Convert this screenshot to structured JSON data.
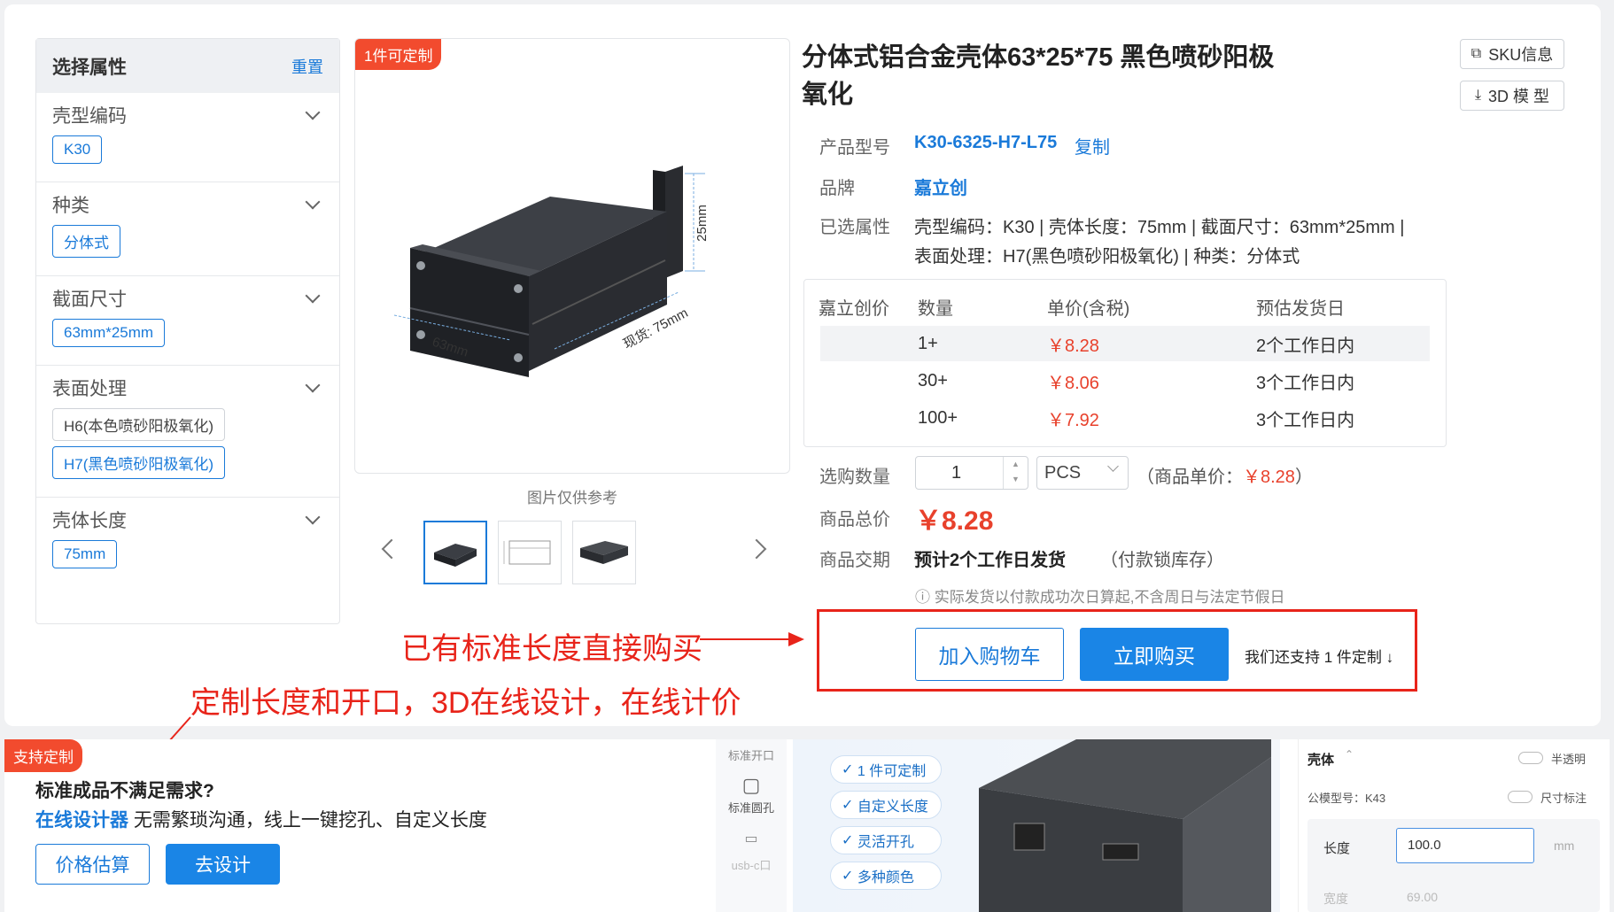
{
  "filter": {
    "title": "选择属性",
    "reset": "重置",
    "sections": [
      {
        "label": "壳型编码",
        "options": [
          "K30"
        ]
      },
      {
        "label": "种类",
        "options": [
          "分体式"
        ]
      },
      {
        "label": "截面尺寸",
        "options": [
          "63mm*25mm"
        ]
      },
      {
        "label": "表面处理",
        "options": [
          "H6(本色喷砂阳极氧化)",
          "H7(黑色喷砂阳极氧化)"
        ]
      },
      {
        "label": "壳体长度",
        "options": [
          "75mm"
        ]
      }
    ]
  },
  "gallery": {
    "badge": "1件可定制",
    "dim_height": "25mm",
    "dim_width": "63mm",
    "dim_length": "现货: 75mm",
    "note": "图片仅供参考"
  },
  "product": {
    "title_line1": "分体式铝合金壳体63*25*75 黑色喷砂阳极",
    "title_line2": "氧化",
    "sku_button": "SKU信息",
    "model3d_button": "3D 模 型",
    "model_label": "产品型号",
    "model_value": "K30-6325-H7-L75",
    "copy": "复制",
    "brand_label": "品牌",
    "brand_value": "嘉立创",
    "attr_label": "已选属性",
    "attr_line1": "壳型编码：K30 | 壳体长度：75mm | 截面尺寸：63mm*25mm |",
    "attr_line2": "表面处理：H7(黑色喷砂阳极氧化) | 种类：分体式"
  },
  "price_table": {
    "headers": [
      "嘉立创价",
      "数量",
      "单价(含税)",
      "预估发货日"
    ],
    "rows": [
      {
        "qty": "1+",
        "price": "￥8.28",
        "ship": "2个工作日内"
      },
      {
        "qty": "30+",
        "price": "￥8.06",
        "ship": "3个工作日内"
      },
      {
        "qty": "100+",
        "price": "￥7.92",
        "ship": "3个工作日内"
      }
    ]
  },
  "order": {
    "qty_label": "选购数量",
    "qty_value": "1",
    "unit": "PCS",
    "unit_price_prefix": "（商品单价：",
    "unit_price": "￥8.28",
    "unit_price_suffix": "）",
    "total_label": "商品总价",
    "total_value": "￥8.28",
    "delivery_label": "商品交期",
    "delivery_value": "预计2个工作日发货",
    "delivery_note": "（付款锁库存）",
    "hint": "实际发货以付款成功次日算起,不含周日与法定节假日",
    "cart_button": "加入购物车",
    "buy_button": "立即购买",
    "custom_support": "我们还支持 1 件定制"
  },
  "annotations": {
    "buy_direct": "已有标准长度直接购买",
    "custom_design": "定制长度和开口，3D在线设计，在线计价"
  },
  "promo": {
    "badge": "支持定制",
    "heading": "标准成品不满足需求?",
    "link": "在线设计器",
    "desc": " 无需繁琐沟通，线上一键挖孔、自定义长度",
    "estimate_button": "价格估算",
    "design_button": "去设计",
    "side_top": "标准开口",
    "side_round": "标准圆孔",
    "side_usbc": "usb-c口",
    "features": [
      "1 件可定制",
      "自定义长度",
      "灵活开孔",
      "多种颜色"
    ],
    "panel_title": "壳体",
    "toggle_translucent": "半透明",
    "model_no": "公模型号：K43",
    "toggle_dims": "尺寸标注",
    "length_label": "长度",
    "length_value": "100.0",
    "length_unit": "mm",
    "width_label": "宽度",
    "width_value": "69.00"
  }
}
